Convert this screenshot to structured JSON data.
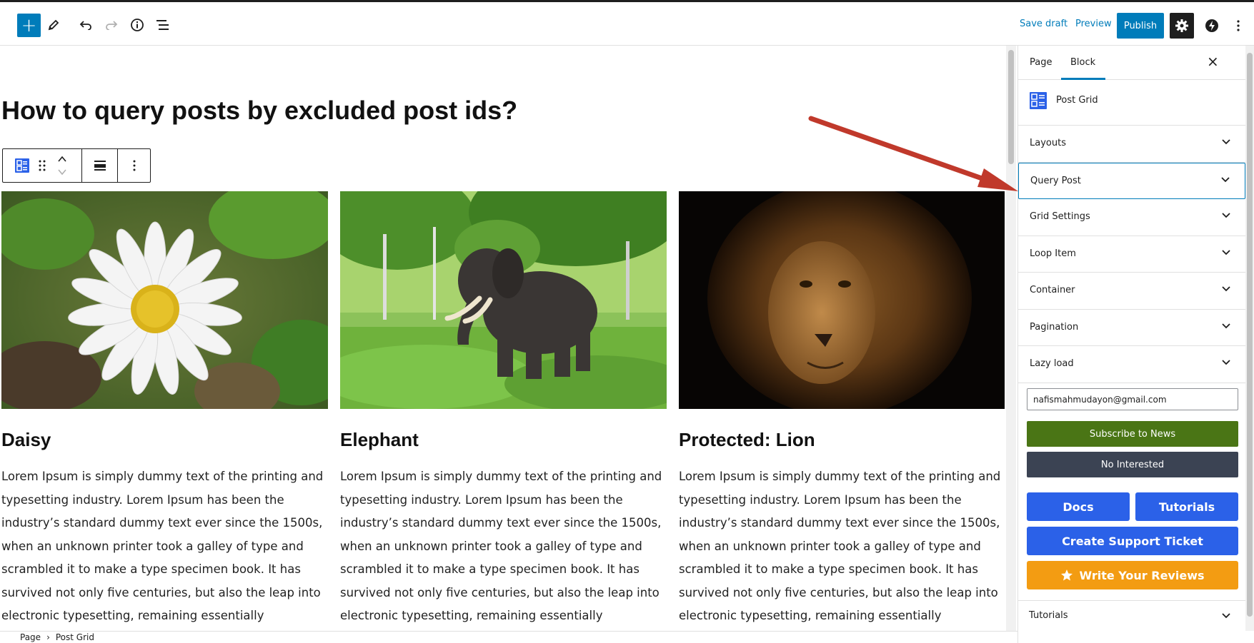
{
  "toolbar": {
    "add_label": "+",
    "save_draft": "Save draft",
    "preview": "Preview",
    "publish": "Publish",
    "icons": [
      "plus-icon",
      "pencil-icon",
      "undo-icon",
      "redo-icon",
      "info-icon",
      "list-view-icon",
      "gear-icon",
      "jetpack-icon",
      "more-vertical-icon"
    ]
  },
  "editor": {
    "post_title": "How to query posts by excluded post ids?",
    "posts": [
      {
        "title": "Daisy",
        "excerpt": "Lorem Ipsum is simply dummy text of the printing and typesetting industry. Lorem Ipsum has been the industry’s standard dummy text ever since the 1500s, when an unknown printer took a galley of type and scrambled it to make a type specimen book. It has survived not only five centuries, but also the leap into electronic typesetting, remaining essentially unchanged."
      },
      {
        "title": "Elephant",
        "excerpt": "Lorem Ipsum is simply dummy text of the printing and typesetting industry. Lorem Ipsum has been the industry’s standard dummy text ever since the 1500s, when an unknown printer took a galley of type and scrambled it to make a type specimen book. It has survived not only five centuries, but also the leap into electronic typesetting, remaining essentially unchanged."
      },
      {
        "title": "Protected: Lion",
        "excerpt": "Lorem Ipsum is simply dummy text of the printing and typesetting industry. Lorem Ipsum has been the industry’s standard dummy text ever since the 1500s, when an unknown printer took a galley of type and scrambled it to make a type specimen book. It has survived not only five centuries, but also the leap into electronic typesetting, remaining essentially unchanged."
      }
    ]
  },
  "breadcrumb": {
    "root": "Page",
    "separator": "›",
    "current": "Post Grid"
  },
  "sidebar": {
    "tabs": [
      "Page",
      "Block"
    ],
    "active_tab": "Block",
    "close": "×",
    "block_name": "Post Grid",
    "panels": [
      "Layouts",
      "Query Post",
      "Grid Settings",
      "Loop Item",
      "Container",
      "Pagination",
      "Lazy load"
    ],
    "email_value": "nafismahmudayon@gmail.com",
    "subscribe": "Subscribe to News",
    "no_interest": "No Interested",
    "docs": "Docs",
    "tutorials_btn": "Tutorials",
    "support_ticket": "Create Support Ticket",
    "reviews": "Write Your Reviews",
    "tutorials_panel": "Tutorials"
  },
  "colors": {
    "wp_blue": "#007cba",
    "subscribe_green": "#4a7515",
    "no_interest_slate": "#3b4353",
    "action_blue": "#2b61e8",
    "review_orange": "#f39c12",
    "annotation_arrow": "#c0392b"
  }
}
